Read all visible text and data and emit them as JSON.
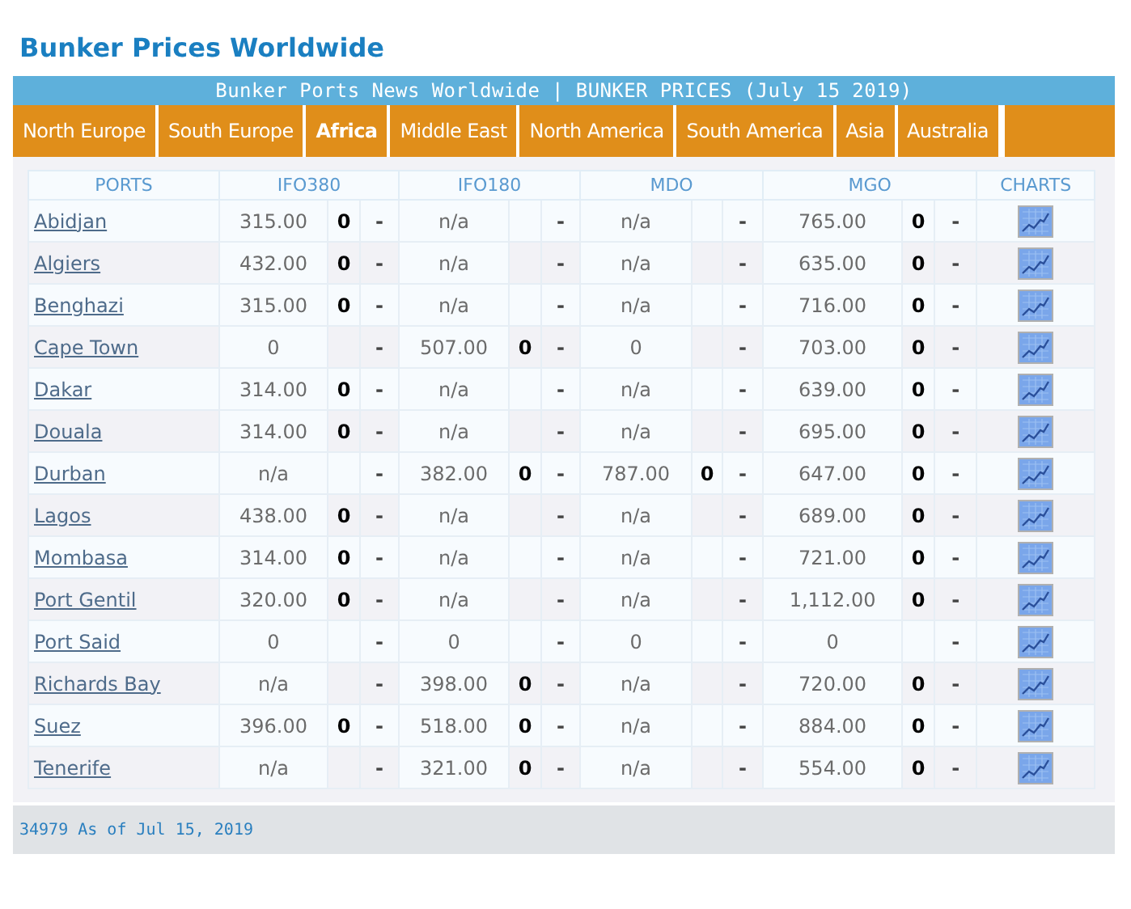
{
  "page_title": "Bunker Prices Worldwide",
  "banner": "Bunker Ports News Worldwide | BUNKER PRICES (July 15 2019)",
  "tabs": [
    {
      "label": "North Europe",
      "selected": false
    },
    {
      "label": "South Europe",
      "selected": false
    },
    {
      "label": "Africa",
      "selected": true
    },
    {
      "label": "Middle East",
      "selected": false
    },
    {
      "label": "North America",
      "selected": false
    },
    {
      "label": "South America",
      "selected": false
    },
    {
      "label": "Asia",
      "selected": false
    },
    {
      "label": "Australia",
      "selected": false
    }
  ],
  "table": {
    "columns": [
      "PORTS",
      "IFO380",
      "IFO180",
      "MDO",
      "MGO",
      "CHARTS"
    ],
    "rows": [
      {
        "port": "Abidjan",
        "prices": [
          {
            "price": "315.00",
            "change": "0",
            "trend": "-"
          },
          {
            "price": "n/a",
            "trend": "-"
          },
          {
            "price": "n/a",
            "trend": "-"
          },
          {
            "price": "765.00",
            "change": "0",
            "trend": "-"
          }
        ]
      },
      {
        "port": "Algiers",
        "prices": [
          {
            "price": "432.00",
            "change": "0",
            "trend": "-"
          },
          {
            "price": "n/a",
            "trend": "-"
          },
          {
            "price": "n/a",
            "trend": "-"
          },
          {
            "price": "635.00",
            "change": "0",
            "trend": "-"
          }
        ]
      },
      {
        "port": "Benghazi",
        "prices": [
          {
            "price": "315.00",
            "change": "0",
            "trend": "-"
          },
          {
            "price": "n/a",
            "trend": "-"
          },
          {
            "price": "n/a",
            "trend": "-"
          },
          {
            "price": "716.00",
            "change": "0",
            "trend": "-"
          }
        ]
      },
      {
        "port": "Cape Town",
        "prices": [
          {
            "price": "0",
            "trend": "-"
          },
          {
            "price": "507.00",
            "change": "0",
            "trend": "-"
          },
          {
            "price": "0",
            "trend": "-"
          },
          {
            "price": "703.00",
            "change": "0",
            "trend": "-"
          }
        ]
      },
      {
        "port": "Dakar",
        "prices": [
          {
            "price": "314.00",
            "change": "0",
            "trend": "-"
          },
          {
            "price": "n/a",
            "trend": "-"
          },
          {
            "price": "n/a",
            "trend": "-"
          },
          {
            "price": "639.00",
            "change": "0",
            "trend": "-"
          }
        ]
      },
      {
        "port": "Douala",
        "prices": [
          {
            "price": "314.00",
            "change": "0",
            "trend": "-"
          },
          {
            "price": "n/a",
            "trend": "-"
          },
          {
            "price": "n/a",
            "trend": "-"
          },
          {
            "price": "695.00",
            "change": "0",
            "trend": "-"
          }
        ]
      },
      {
        "port": "Durban",
        "prices": [
          {
            "price": "n/a",
            "trend": "-"
          },
          {
            "price": "382.00",
            "change": "0",
            "trend": "-"
          },
          {
            "price": "787.00",
            "change": "0",
            "trend": "-"
          },
          {
            "price": "647.00",
            "change": "0",
            "trend": "-"
          }
        ]
      },
      {
        "port": "Lagos",
        "prices": [
          {
            "price": "438.00",
            "change": "0",
            "trend": "-"
          },
          {
            "price": "n/a",
            "trend": "-"
          },
          {
            "price": "n/a",
            "trend": "-"
          },
          {
            "price": "689.00",
            "change": "0",
            "trend": "-"
          }
        ]
      },
      {
        "port": "Mombasa",
        "prices": [
          {
            "price": "314.00",
            "change": "0",
            "trend": "-"
          },
          {
            "price": "n/a",
            "trend": "-"
          },
          {
            "price": "n/a",
            "trend": "-"
          },
          {
            "price": "721.00",
            "change": "0",
            "trend": "-"
          }
        ]
      },
      {
        "port": "Port Gentil",
        "prices": [
          {
            "price": "320.00",
            "change": "0",
            "trend": "-"
          },
          {
            "price": "n/a",
            "trend": "-"
          },
          {
            "price": "n/a",
            "trend": "-"
          },
          {
            "price": "1,112.00",
            "change": "0",
            "trend": "-"
          }
        ]
      },
      {
        "port": "Port Said",
        "prices": [
          {
            "price": "0",
            "trend": "-"
          },
          {
            "price": "0",
            "trend": "-"
          },
          {
            "price": "0",
            "trend": "-"
          },
          {
            "price": "0",
            "trend": "-"
          }
        ]
      },
      {
        "port": "Richards Bay",
        "prices": [
          {
            "price": "n/a",
            "trend": "-"
          },
          {
            "price": "398.00",
            "change": "0",
            "trend": "-"
          },
          {
            "price": "n/a",
            "trend": "-"
          },
          {
            "price": "720.00",
            "change": "0",
            "trend": "-"
          }
        ]
      },
      {
        "port": "Suez",
        "prices": [
          {
            "price": "396.00",
            "change": "0",
            "trend": "-"
          },
          {
            "price": "518.00",
            "change": "0",
            "trend": "-"
          },
          {
            "price": "n/a",
            "trend": "-"
          },
          {
            "price": "884.00",
            "change": "0",
            "trend": "-"
          }
        ]
      },
      {
        "port": "Tenerife",
        "prices": [
          {
            "price": "n/a",
            "trend": "-"
          },
          {
            "price": "321.00",
            "change": "0",
            "trend": "-"
          },
          {
            "price": "n/a",
            "trend": "-"
          },
          {
            "price": "554.00",
            "change": "0",
            "trend": "-"
          }
        ]
      }
    ]
  },
  "footer": "34979 As of Jul 15, 2019"
}
